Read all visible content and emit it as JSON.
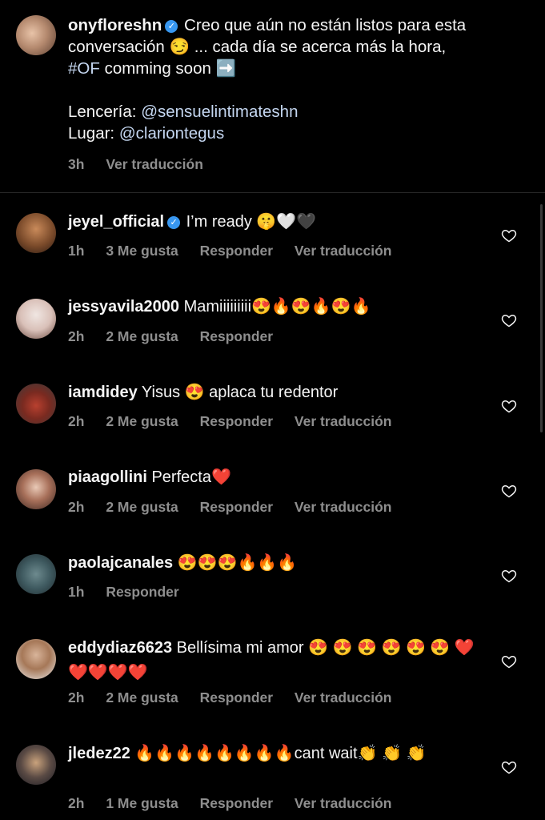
{
  "post": {
    "username": "onyfloreshn",
    "text_1": "Creo que aún no están listos para esta conversación 😏 ... cada día se acerca más la hora,",
    "hashtag": "#OF",
    "text_2": "comming soon",
    "arrow_emoji": "➡️",
    "lenceria_label": "Lencería:",
    "lenceria_handle": "@sensuelintimateshn",
    "lugar_label": "Lugar:",
    "lugar_handle": "@clariontegus",
    "time": "3h",
    "translate": "Ver traducción"
  },
  "comments": [
    {
      "username": "jeyel_official",
      "verified": true,
      "text": "I’m ready 🤫🤍🖤",
      "time": "1h",
      "likes": "3 Me gusta",
      "reply": "Responder",
      "translate": "Ver traducción"
    },
    {
      "username": "jessyavila2000",
      "text": "Mamiiiiiiiii😍🔥😍🔥😍🔥",
      "time": "2h",
      "likes": "2 Me gusta",
      "reply": "Responder"
    },
    {
      "username": "iamdidey",
      "text": "Yisus 😍 aplaca  tu redentor",
      "time": "2h",
      "likes": "2 Me gusta",
      "reply": "Responder",
      "translate": "Ver traducción"
    },
    {
      "username": "piaagollini",
      "text": "Perfecta❤️",
      "time": "2h",
      "likes": "2 Me gusta",
      "reply": "Responder",
      "translate": "Ver traducción"
    },
    {
      "username": "paolajcanales",
      "text": "😍😍😍🔥🔥🔥",
      "time": "1h",
      "reply": "Responder"
    },
    {
      "username": "eddydiaz6623",
      "text": "Bellísima mi amor 😍 😍 😍 😍 😍 😍 ❤️❤️❤️❤️❤️",
      "time": "2h",
      "likes": "2 Me gusta",
      "reply": "Responder",
      "translate": "Ver traducción"
    },
    {
      "username": "jledez22",
      "text": "🔥🔥🔥🔥🔥🔥🔥🔥cant wait👏 👏 👏",
      "time": "2h",
      "likes": "1 Me gusta",
      "reply": "Responder",
      "translate": "Ver traducción"
    }
  ],
  "colors": {
    "background": "#000000",
    "text": "#f5f5f5",
    "muted": "#8e8e8e",
    "link": "#c4d6f0",
    "verified": "#3897f0"
  },
  "icons": [
    "verified-badge-icon",
    "heart-outline-icon"
  ]
}
